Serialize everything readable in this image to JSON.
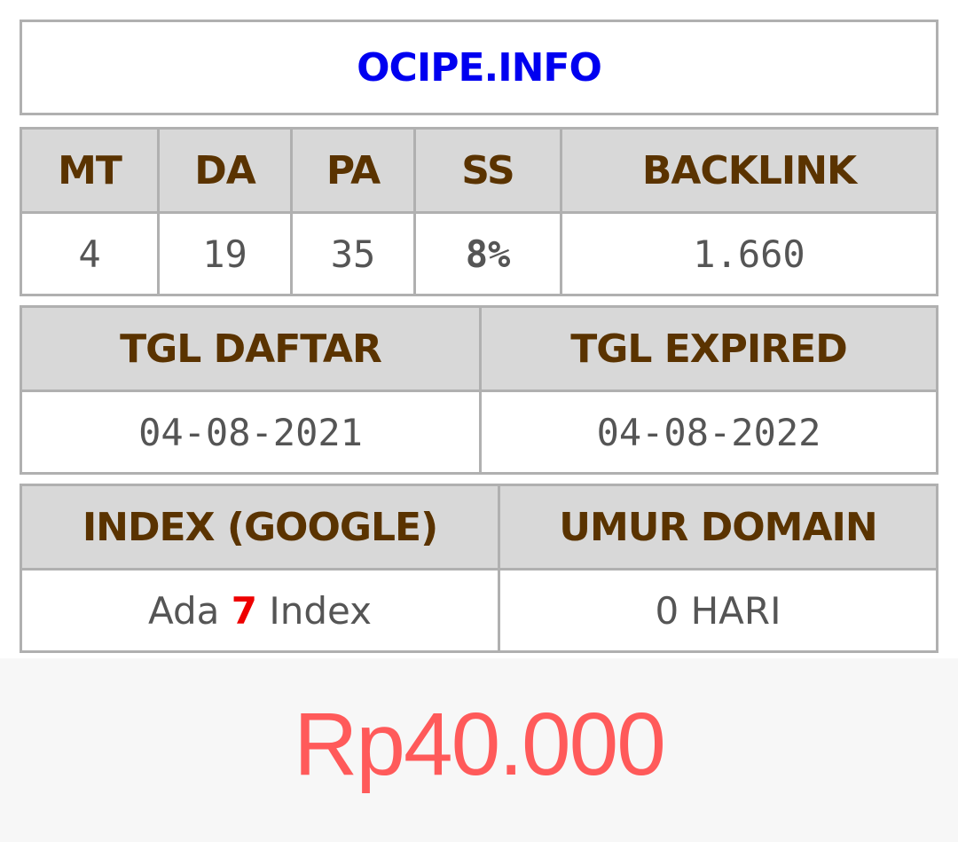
{
  "domain": "OCIPE.INFO",
  "metrics": {
    "headers": [
      "MT",
      "DA",
      "PA",
      "SS",
      "BACKLINK"
    ],
    "values": [
      "4",
      "19",
      "35",
      "8%",
      "1.660"
    ]
  },
  "dates": {
    "headers": [
      "TGL DAFTAR",
      "TGL EXPIRED"
    ],
    "values": [
      "04-08-2021",
      "04-08-2022"
    ]
  },
  "index": {
    "headers": [
      "INDEX (GOOGLE)",
      "UMUR DOMAIN"
    ],
    "index_prefix": "Ada",
    "index_count": "7",
    "index_suffix": "Index",
    "age": "0 HARI"
  },
  "price": "Rp40.000",
  "colors": {
    "domain": "#0000f0",
    "header_text": "#5a3300",
    "ss_value": "#0a8a0a",
    "index_count": "#ee0000",
    "price": "#ff5a5a"
  }
}
